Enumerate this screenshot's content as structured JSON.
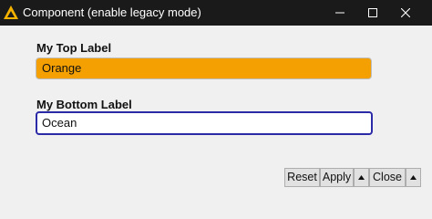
{
  "window": {
    "title": "Component (enable legacy mode)",
    "icon": "component-logo-icon",
    "controls": [
      "minimize-icon",
      "maximize-icon",
      "close-icon"
    ]
  },
  "form": {
    "top_label": "My Top Label",
    "top_value": "Orange",
    "top_value_color": "#f5a002",
    "bottom_label": "My Bottom Label",
    "bottom_value": "Ocean",
    "focus_border_color": "#2b2ba8"
  },
  "footer": {
    "reset_label": "Reset",
    "apply_label": "Apply",
    "apply_menu_icon": "caret-up-icon",
    "close_label": "Close",
    "close_menu_icon": "caret-up-icon"
  }
}
